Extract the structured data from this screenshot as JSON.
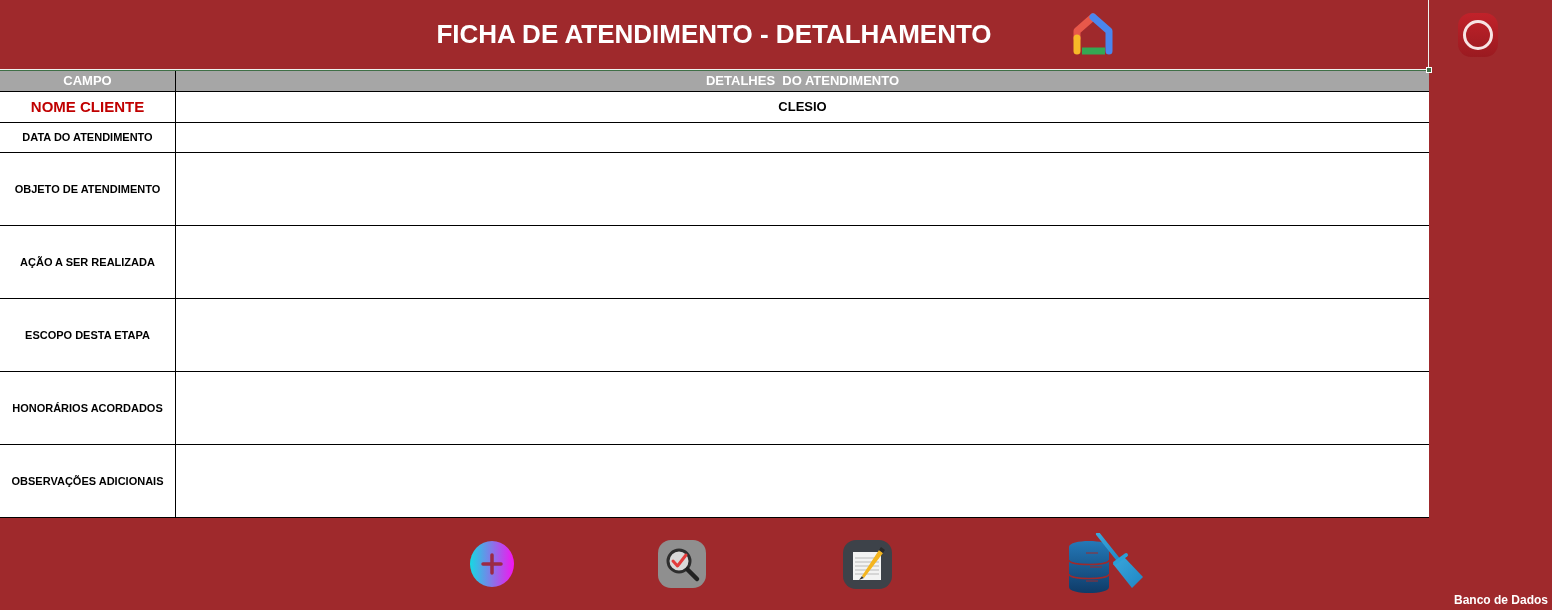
{
  "header": {
    "title": "FICHA DE ATENDIMENTO - DETALHAMENTO"
  },
  "table": {
    "columns": [
      "CAMPO",
      "DETALHES  DO ATENDIMENTO"
    ],
    "rows": [
      {
        "kind": "highlight",
        "label": "NOME CLIENTE",
        "value": "CLESIO"
      },
      {
        "kind": "short",
        "label": "DATA DO ATENDIMENTO"
      },
      {
        "kind": "tall",
        "label": "OBJETO DE ATENDIMENTO"
      },
      {
        "kind": "tall",
        "label": "AÇÃO A SER REALIZADA"
      },
      {
        "kind": "tall",
        "label": "ESCOPO DESTA ETAPA"
      },
      {
        "kind": "tall",
        "label": "HONORÁRIOS ACORDADOS"
      },
      {
        "kind": "tall",
        "label": "OBSERVAÇÕES ADICIONAIS"
      }
    ]
  },
  "footer": {
    "label": "Banco de Dados"
  }
}
